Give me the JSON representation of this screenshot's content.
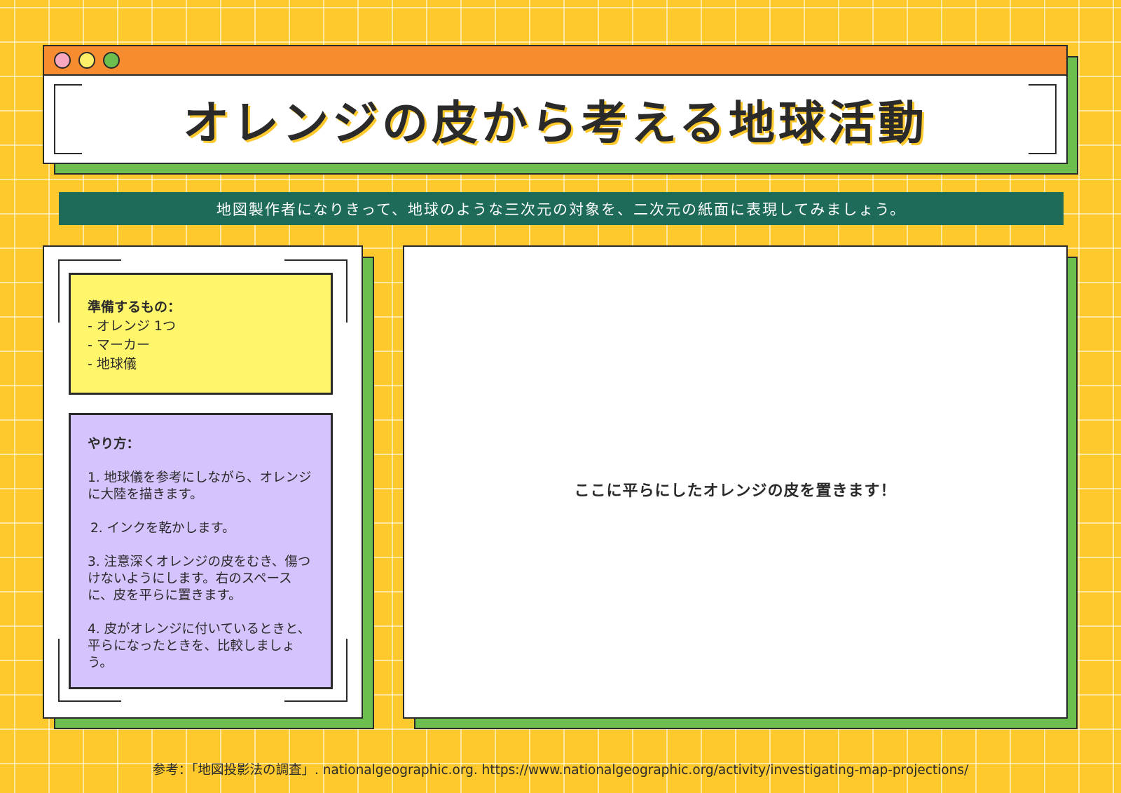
{
  "header": {
    "title": "オレンジの皮から考える地球活動"
  },
  "subtitle": "地図製作者になりきって、地球のような三次元の対象を、二次元の紙面に表現してみましょう。",
  "materials": {
    "heading": "準備するもの：",
    "items": [
      "- オレンジ 1つ",
      "- マーカー",
      "- 地球儀"
    ]
  },
  "steps": {
    "heading": "やり方：",
    "items": [
      "1. 地球儀を参考にしながら、オレンジに大陸を描きます。",
      "2. インクを乾かします。",
      "3. 注意深くオレンジの皮をむき、傷つけないようにします。右のスペースに、皮を平らに置きます。",
      "4. 皮がオレンジに付いているときと、平らになったときを、比較しましょう。"
    ]
  },
  "placeholder": "ここに平らにしたオレンジの皮を置きます！",
  "footer": "参考：「地図投影法の調査」. nationalgeographic.org. https://www.nationalgeographic.org/activity/investigating-map-projections/",
  "colors": {
    "background": "#fec92c",
    "title_bar": "#f68b30",
    "shadow_green": "#6cbf4f",
    "subtitle_bar": "#1f6b5a",
    "materials_box": "#fff66b",
    "steps_box": "#d5c3fd"
  }
}
